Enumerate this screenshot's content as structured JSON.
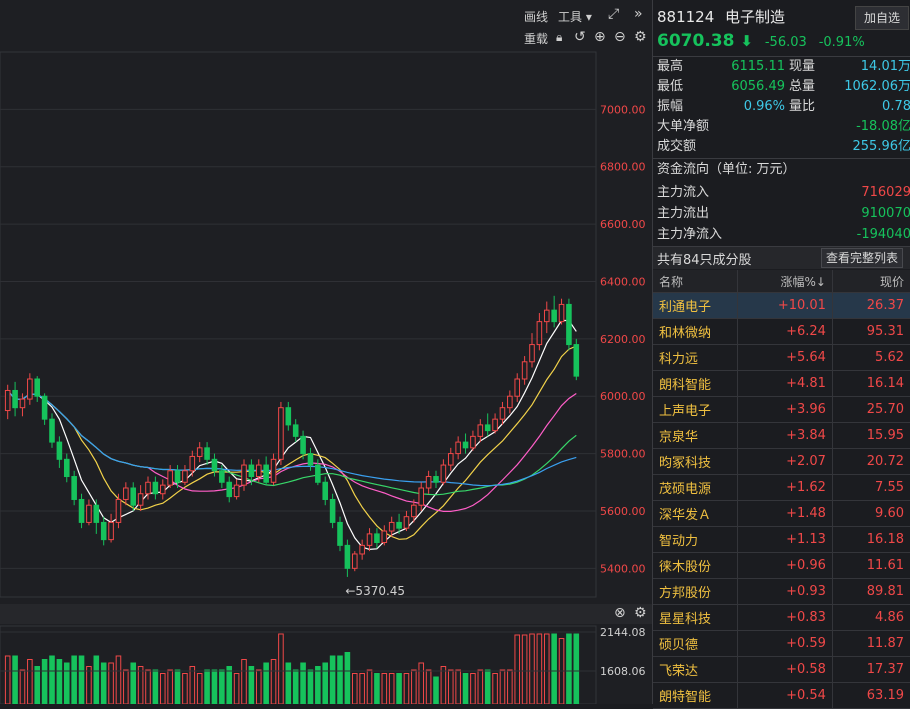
{
  "toolbar": {
    "draw_label": "画线",
    "tools_label": "工具",
    "reload_label": "重载",
    "collapse_label": "»"
  },
  "index": {
    "code": "881124",
    "name": "电子制造",
    "add_button": "加自选",
    "price": "6070.38",
    "change": "-56.03",
    "change_pct": "-0.91%"
  },
  "stats": {
    "high_label": "最高",
    "high": "6115.11",
    "now_vol_label": "现量",
    "now_vol": "14.01万",
    "low_label": "最低",
    "low": "6056.49",
    "total_vol_label": "总量",
    "total_vol": "1062.06万",
    "amp_label": "振幅",
    "amp": "0.96%",
    "vol_ratio_label": "量比",
    "vol_ratio": "0.78",
    "big_net_label": "大单净额",
    "big_net": "-18.08亿",
    "turnover_label": "成交额",
    "turnover": "255.96亿"
  },
  "flow": {
    "title": "资金流向（单位: 万元）",
    "in_label": "主力流入",
    "in": "716029",
    "out_label": "主力流出",
    "out": "910070",
    "net_label": "主力净流入",
    "net": "-194040"
  },
  "constituents": {
    "count_label": "共有84只成分股",
    "view_all_button": "查看完整列表",
    "headers": [
      "名称",
      "涨幅%↓",
      "现价"
    ],
    "rows": [
      [
        "利通电子",
        "+10.01",
        "26.37"
      ],
      [
        "和林微纳",
        "+6.24",
        "95.31"
      ],
      [
        "科力远",
        "+5.64",
        "5.62"
      ],
      [
        "朗科智能",
        "+4.81",
        "16.14"
      ],
      [
        "上声电子",
        "+3.96",
        "25.70"
      ],
      [
        "京泉华",
        "+3.84",
        "15.95"
      ],
      [
        "昀冢科技",
        "+2.07",
        "20.72"
      ],
      [
        "茂硕电源",
        "+1.62",
        "7.55"
      ],
      [
        "深华发Ａ",
        "+1.48",
        "9.60"
      ],
      [
        "智动力",
        "+1.13",
        "16.18"
      ],
      [
        "徕木股份",
        "+0.96",
        "11.61"
      ],
      [
        "方邦股份",
        "+0.93",
        "89.81"
      ],
      [
        "星星科技",
        "+0.83",
        "4.86"
      ],
      [
        "硕贝德",
        "+0.59",
        "11.87"
      ],
      [
        "飞荣达",
        "+0.58",
        "17.37"
      ],
      [
        "朗特智能",
        "+0.54",
        "63.19"
      ]
    ]
  },
  "colors": {
    "up": "#f04848",
    "down": "#16c25c",
    "accent": "#3ec8e6",
    "name": "#f0c040"
  },
  "chart_data": {
    "type": "candlestick",
    "y_ticks": [
      "7000.00",
      "6800.00",
      "6600.00",
      "6400.00",
      "6200.00",
      "6000.00",
      "5800.00",
      "5600.00",
      "5400.00"
    ],
    "ylim": [
      5300,
      7200
    ],
    "min_label": "←5370.45",
    "volume_ticks": [
      "2144.08",
      "1608.06"
    ],
    "candles": [
      [
        5950,
        6020,
        5920,
        6040
      ],
      [
        6020,
        5960,
        5930,
        6050
      ],
      [
        5960,
        5990,
        5930,
        6010
      ],
      [
        5990,
        6060,
        5970,
        6080
      ],
      [
        6060,
        6000,
        5980,
        6070
      ],
      [
        6000,
        5920,
        5900,
        6010
      ],
      [
        5920,
        5840,
        5820,
        5940
      ],
      [
        5840,
        5780,
        5750,
        5860
      ],
      [
        5780,
        5720,
        5700,
        5800
      ],
      [
        5720,
        5640,
        5620,
        5740
      ],
      [
        5640,
        5560,
        5540,
        5660
      ],
      [
        5560,
        5620,
        5550,
        5640
      ],
      [
        5620,
        5560,
        5520,
        5640
      ],
      [
        5560,
        5500,
        5480,
        5580
      ],
      [
        5500,
        5560,
        5490,
        5590
      ],
      [
        5560,
        5640,
        5540,
        5660
      ],
      [
        5640,
        5680,
        5620,
        5700
      ],
      [
        5680,
        5620,
        5600,
        5700
      ],
      [
        5620,
        5660,
        5600,
        5690
      ],
      [
        5660,
        5700,
        5640,
        5720
      ],
      [
        5700,
        5660,
        5640,
        5720
      ],
      [
        5660,
        5690,
        5640,
        5710
      ],
      [
        5690,
        5740,
        5680,
        5760
      ],
      [
        5740,
        5700,
        5680,
        5760
      ],
      [
        5700,
        5740,
        5690,
        5760
      ],
      [
        5740,
        5790,
        5720,
        5810
      ],
      [
        5790,
        5820,
        5770,
        5840
      ],
      [
        5820,
        5780,
        5760,
        5840
      ],
      [
        5780,
        5740,
        5720,
        5800
      ],
      [
        5740,
        5700,
        5680,
        5760
      ],
      [
        5700,
        5650,
        5630,
        5720
      ],
      [
        5650,
        5690,
        5640,
        5710
      ],
      [
        5690,
        5760,
        5670,
        5780
      ],
      [
        5760,
        5720,
        5690,
        5780
      ],
      [
        5720,
        5760,
        5700,
        5780
      ],
      [
        5760,
        5700,
        5690,
        5790
      ],
      [
        5700,
        5780,
        5690,
        5800
      ],
      [
        5780,
        5960,
        5760,
        5980
      ],
      [
        5960,
        5900,
        5880,
        5980
      ],
      [
        5900,
        5860,
        5840,
        5920
      ],
      [
        5860,
        5800,
        5780,
        5880
      ],
      [
        5800,
        5760,
        5740,
        5820
      ],
      [
        5760,
        5700,
        5690,
        5780
      ],
      [
        5700,
        5640,
        5620,
        5720
      ],
      [
        5640,
        5560,
        5540,
        5660
      ],
      [
        5560,
        5480,
        5460,
        5580
      ],
      [
        5480,
        5400,
        5370,
        5500
      ],
      [
        5400,
        5450,
        5390,
        5460
      ],
      [
        5450,
        5480,
        5430,
        5500
      ],
      [
        5480,
        5520,
        5460,
        5540
      ],
      [
        5520,
        5490,
        5470,
        5540
      ],
      [
        5490,
        5530,
        5480,
        5550
      ],
      [
        5530,
        5560,
        5510,
        5580
      ],
      [
        5560,
        5540,
        5520,
        5590
      ],
      [
        5540,
        5580,
        5530,
        5600
      ],
      [
        5580,
        5620,
        5560,
        5640
      ],
      [
        5620,
        5680,
        5600,
        5700
      ],
      [
        5680,
        5720,
        5660,
        5740
      ],
      [
        5720,
        5700,
        5680,
        5740
      ],
      [
        5700,
        5760,
        5690,
        5780
      ],
      [
        5760,
        5800,
        5740,
        5820
      ],
      [
        5800,
        5840,
        5780,
        5860
      ],
      [
        5840,
        5820,
        5800,
        5870
      ],
      [
        5820,
        5860,
        5810,
        5880
      ],
      [
        5860,
        5900,
        5840,
        5920
      ],
      [
        5900,
        5880,
        5860,
        5940
      ],
      [
        5880,
        5920,
        5870,
        5940
      ],
      [
        5920,
        5960,
        5900,
        5980
      ],
      [
        5960,
        6000,
        5940,
        6020
      ],
      [
        6000,
        6060,
        5980,
        6080
      ],
      [
        6060,
        6120,
        6040,
        6140
      ],
      [
        6120,
        6180,
        6100,
        6220
      ],
      [
        6180,
        6260,
        6160,
        6290
      ],
      [
        6260,
        6300,
        6220,
        6330
      ],
      [
        6300,
        6260,
        6240,
        6350
      ],
      [
        6260,
        6320,
        6250,
        6340
      ],
      [
        6320,
        6180,
        6160,
        6340
      ],
      [
        6180,
        6070,
        6056,
        6200
      ]
    ]
  }
}
